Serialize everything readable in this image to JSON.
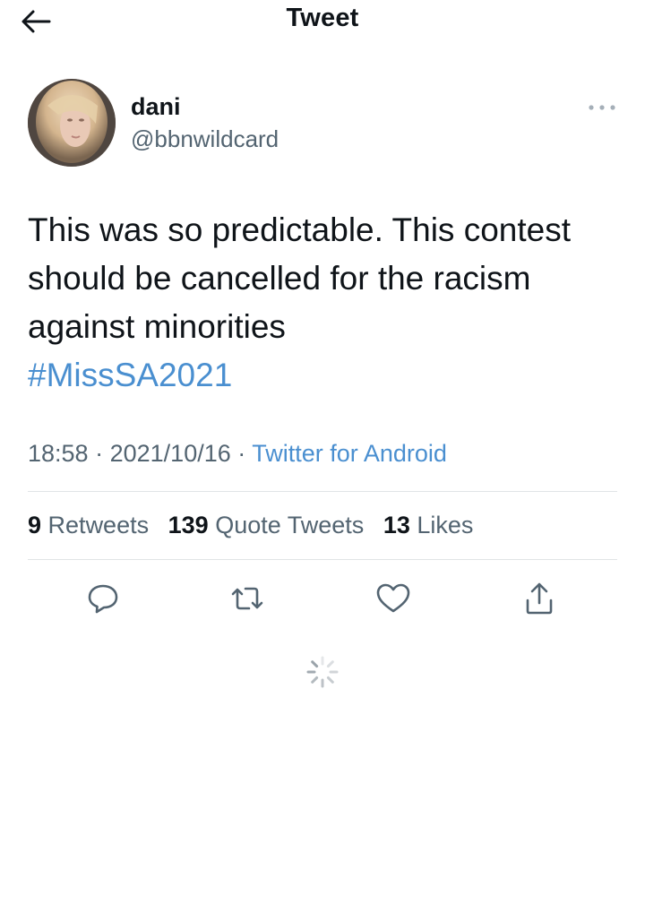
{
  "header": {
    "title": "Tweet",
    "back_icon": "back-arrow-icon"
  },
  "tweet": {
    "author": {
      "name": "dani",
      "handle": "@bbnwildcard"
    },
    "text": "This was so predictable. This contest should be cancelled for the racism against minorities",
    "hashtag": "#MissSA2021",
    "time": "18:58",
    "date": "2021/10/16",
    "separator": "·",
    "source": "Twitter for Android"
  },
  "stats": {
    "retweets_count": "9",
    "retweets_label": "Retweets",
    "quotes_count": "139",
    "quotes_label": "Quote Tweets",
    "likes_count": "13",
    "likes_label": "Likes"
  },
  "actions": [
    "reply-icon",
    "retweet-icon",
    "like-icon",
    "share-icon"
  ],
  "colors": {
    "link": "#4a8fd0",
    "secondary_text": "#536471",
    "divider": "#e1e4e6"
  }
}
